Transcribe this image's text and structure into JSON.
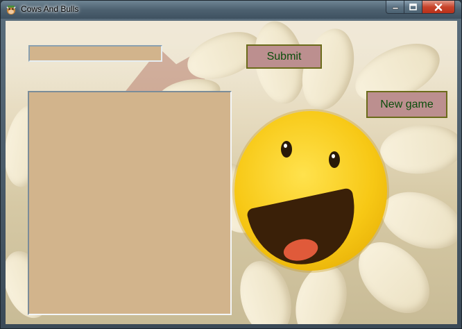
{
  "window": {
    "title": "Cows And Bulls",
    "app_icon": "cow-icon"
  },
  "title_buttons": {
    "minimize_icon": "minimize-icon",
    "maximize_icon": "maximize-icon",
    "close_icon": "close-icon"
  },
  "form": {
    "guess_value": "",
    "submit_label": "Submit",
    "new_game_label": "New game",
    "output_value": ""
  },
  "colors": {
    "field_background": "#d2b48c",
    "button_background": "#bc8f8f",
    "button_text": "#0b4d0b",
    "button_border": "#6b6b1a"
  }
}
